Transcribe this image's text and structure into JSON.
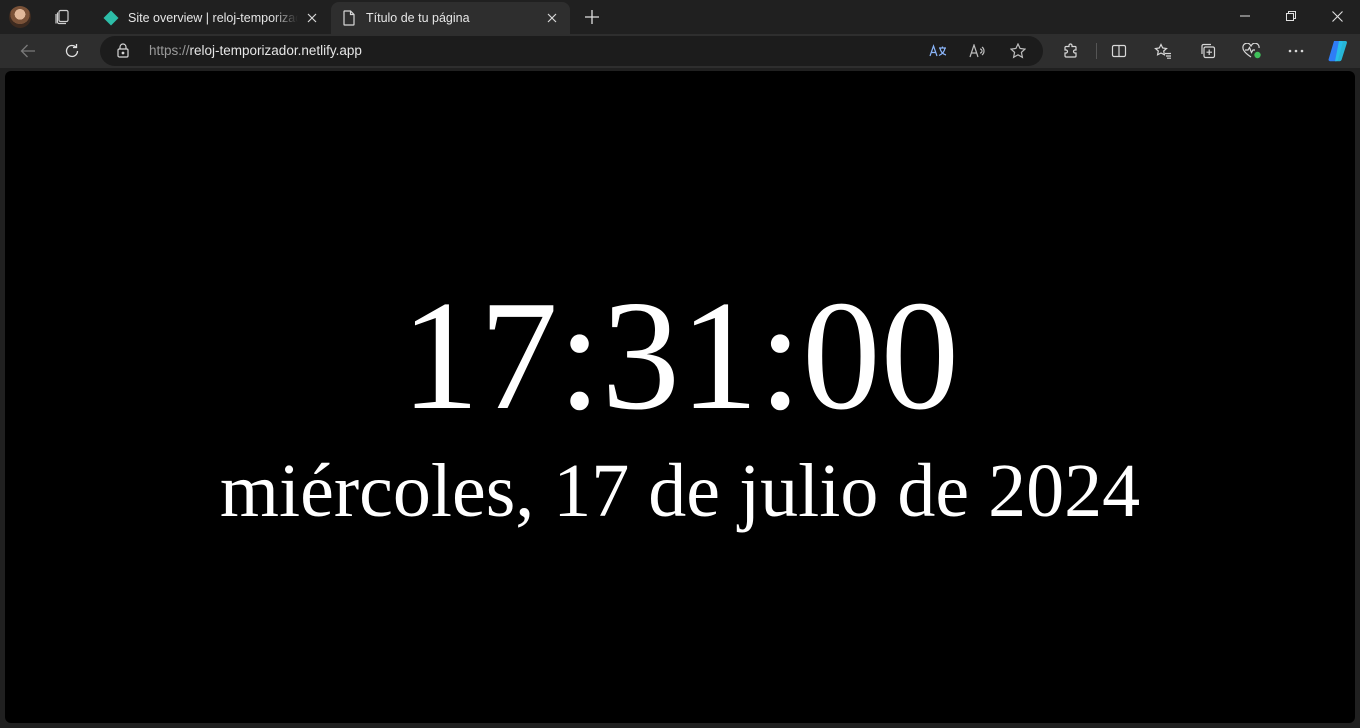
{
  "browser": {
    "tabs": [
      {
        "title": "Site overview | reloj-temporizador",
        "favicon": "netlify-diamond-icon",
        "active": false
      },
      {
        "title": "Título de tu página",
        "favicon": "page-icon",
        "active": true
      }
    ],
    "address_bar": {
      "scheme": "https://",
      "host": "reloj-temporizador.netlify.app"
    },
    "accent_color": "#2dbda8"
  },
  "page": {
    "time": "17:31:00",
    "date": "miércoles, 17 de julio de 2024",
    "background": "#000000",
    "text_color": "#ffffff"
  }
}
